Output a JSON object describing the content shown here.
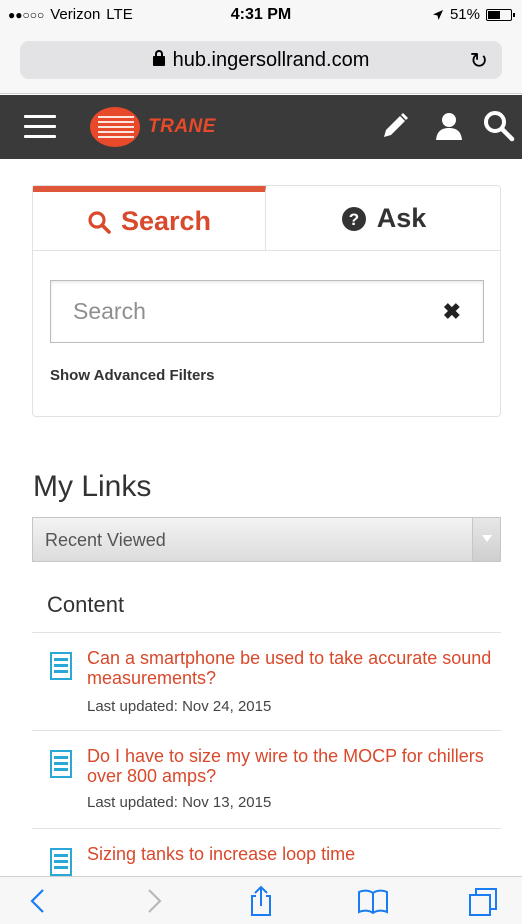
{
  "status_bar": {
    "signal": "●●○○○",
    "carrier": "Verizon",
    "network": "LTE",
    "time": "4:31 PM",
    "location_icon": "location-arrow-icon",
    "battery_percent": "51%",
    "battery_level": 0.51
  },
  "browser": {
    "url": "hub.ingersollrand.com",
    "secure_icon": "lock-icon",
    "reload_icon": "reload-icon"
  },
  "header": {
    "brand": "TRANE",
    "menu_icon": "hamburger-menu-icon",
    "actions": [
      "pencil-icon",
      "user-icon",
      "search-icon"
    ],
    "accent_color": "#e8492a",
    "bar_color": "#3a3a3a"
  },
  "search_card": {
    "tabs": [
      {
        "label": "Search",
        "icon": "search-icon",
        "active": true
      },
      {
        "label": "Ask",
        "icon": "question-circle-icon",
        "active": false
      }
    ],
    "search_placeholder": "Search",
    "search_value": "",
    "clear_icon": "close-x-icon",
    "advanced_filters_label": "Show Advanced Filters"
  },
  "my_links": {
    "title": "My Links",
    "dropdown_selected": "Recent Viewed",
    "section_title": "Content",
    "items": [
      {
        "title": "Can a smartphone be used to take accurate sound measurements?",
        "updated": "Last updated: Nov 24, 2015",
        "icon": "document-icon"
      },
      {
        "title": "Do I have to size my wire to the MOCP for chillers over 800 amps?",
        "updated": "Last updated: Nov 13, 2015",
        "icon": "document-icon"
      },
      {
        "title": "Sizing tanks to increase loop time",
        "updated": "",
        "icon": "document-icon"
      }
    ]
  },
  "toolbar": {
    "items": [
      "back-icon",
      "forward-icon",
      "share-icon",
      "bookmarks-icon",
      "tabs-icon"
    ]
  }
}
